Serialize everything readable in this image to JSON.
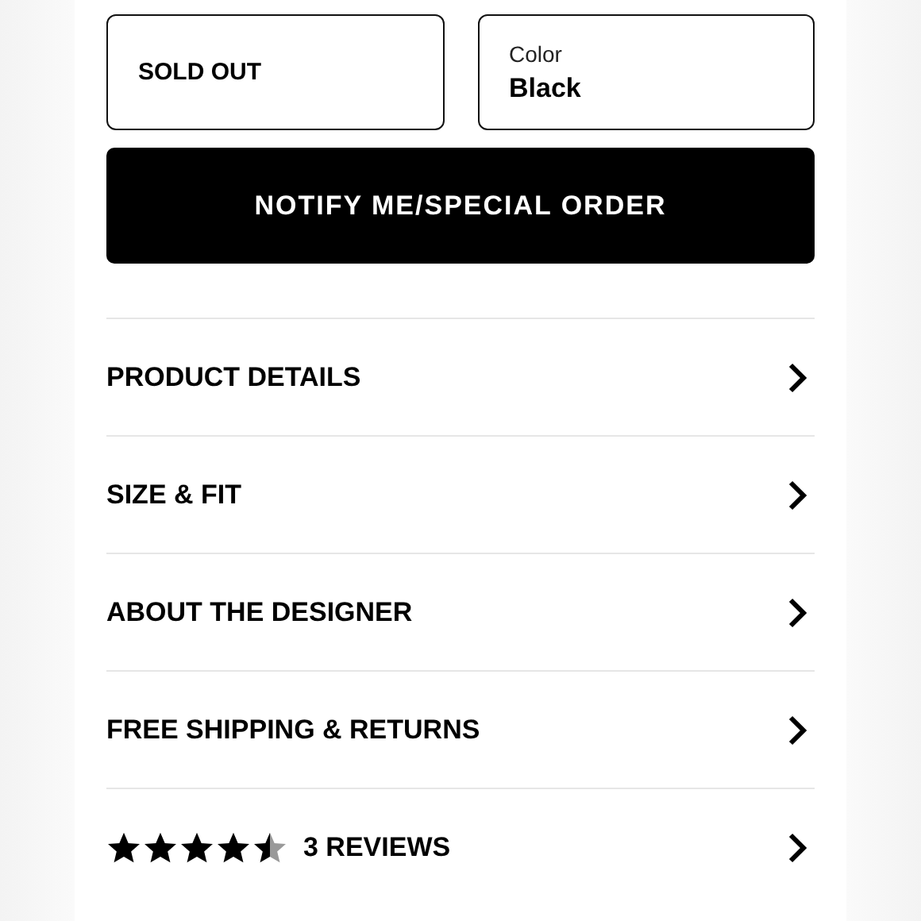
{
  "size_box": {
    "label": "SOLD OUT"
  },
  "color_box": {
    "label": "Color",
    "value": "Black"
  },
  "notify_button": {
    "label": "NOTIFY ME/SPECIAL ORDER"
  },
  "sections": [
    {
      "label": "PRODUCT DETAILS",
      "kind": "text"
    },
    {
      "label": "SIZE & FIT",
      "kind": "text"
    },
    {
      "label": "ABOUT THE DESIGNER",
      "kind": "text"
    },
    {
      "label": "FREE SHIPPING & RETURNS",
      "kind": "text"
    },
    {
      "label": "3 REVIEWS",
      "kind": "reviews",
      "stars": 4.5
    }
  ]
}
